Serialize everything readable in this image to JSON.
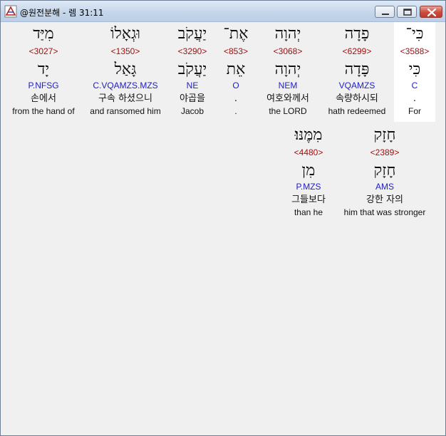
{
  "window": {
    "title": "@원전분해 - 렘 31:11",
    "controls": [
      "minimize",
      "maximize",
      "close"
    ]
  },
  "verse_words": [
    {
      "hebrew": "כִּי־",
      "strong": "<3588>",
      "lemma": "כִּי",
      "parse": "C",
      "korean": ".",
      "english": "For",
      "selected": true
    },
    {
      "hebrew": "פָדָה",
      "strong": "<6299>",
      "lemma": "פָּדָה",
      "parse": "VQAMZS",
      "korean": "속량하시되",
      "english": "hath redeemed",
      "selected": false
    },
    {
      "hebrew": "יְהוָה",
      "strong": "<3068>",
      "lemma": "יְהוָה",
      "parse": "NEM",
      "korean": "여호와께서",
      "english": "the LORD",
      "selected": false
    },
    {
      "hebrew": "אֶת־",
      "strong": "<853>",
      "lemma": "אֵת",
      "parse": "O",
      "korean": ".",
      "english": ".",
      "selected": false
    },
    {
      "hebrew": "יַעֲקֹב",
      "strong": "<3290>",
      "lemma": "יַעֲקֹב",
      "parse": "NE",
      "korean": "야곱을",
      "english": "Jacob",
      "selected": false
    },
    {
      "hebrew": "וּגְאָלוֹ",
      "strong": "<1350>",
      "lemma": "גָּאַל",
      "parse": "C.VQAMZS.MZS",
      "korean": "구속 하셨으니",
      "english": "and ransomed him",
      "selected": false
    },
    {
      "hebrew": "מִיַּד",
      "strong": "<3027>",
      "lemma": "יָד",
      "parse": "P.NFSG",
      "korean": "손에서",
      "english": "from the hand of",
      "selected": false
    },
    {
      "hebrew": "חָזָק",
      "strong": "<2389>",
      "lemma": "חָזָק",
      "parse": "AMS",
      "korean": "강한 자의",
      "english": "him that was stronger",
      "selected": false
    },
    {
      "hebrew": "מִמֶּנּוּ׃",
      "strong": "<4480>",
      "lemma": "מִן",
      "parse": "P.MZS",
      "korean": "그들보다",
      "english": "than he",
      "selected": false
    }
  ]
}
